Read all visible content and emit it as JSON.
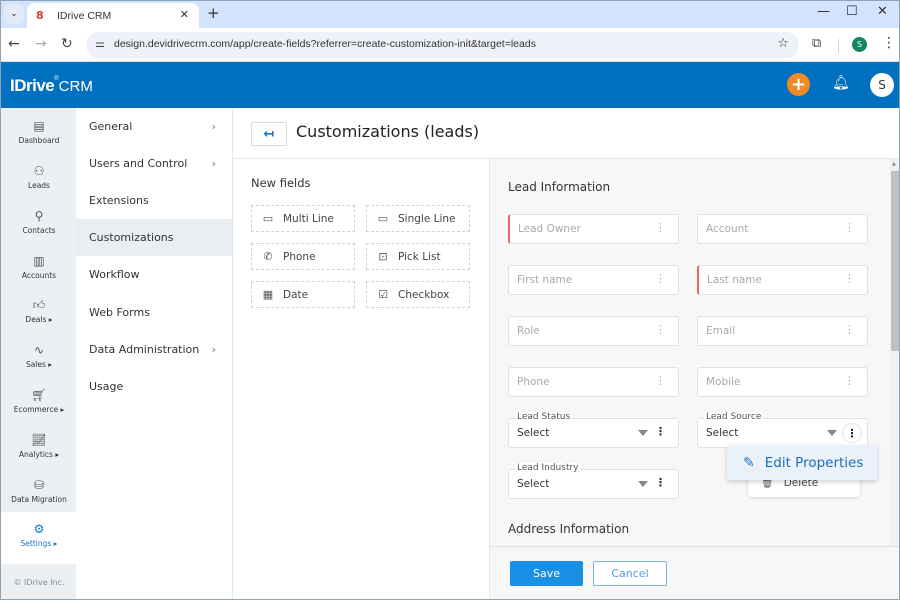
{
  "browser": {
    "tab_title": "IDrive CRM",
    "url": "design.devidrivecrm.com/app/create-fields?referrer=create-customization-init&target=leads",
    "profile_initial": "S"
  },
  "header": {
    "brand": "IDrive",
    "brand_reg": "®",
    "product": "CRM",
    "avatar_initial": "S",
    "accent_color": "#0070c0",
    "add_button_color": "#f08a24"
  },
  "rail": {
    "items": [
      {
        "label": "Dashboard",
        "icon": "dashboard-icon"
      },
      {
        "label": "Leads",
        "icon": "leads-icon"
      },
      {
        "label": "Contacts",
        "icon": "contacts-icon"
      },
      {
        "label": "Accounts",
        "icon": "accounts-icon"
      },
      {
        "label": "Deals ▸",
        "icon": "deals-icon"
      },
      {
        "label": "Sales ▸",
        "icon": "sales-icon"
      },
      {
        "label": "Ecommerce ▸",
        "icon": "ecommerce-icon"
      },
      {
        "label": "Analytics ▸",
        "icon": "analytics-icon"
      },
      {
        "label": "Data Migration",
        "icon": "data-migration-icon"
      },
      {
        "label": "Settings ▸",
        "icon": "settings-icon",
        "active": true
      }
    ],
    "footer": "© IDrive Inc."
  },
  "settings_menu": {
    "items": [
      {
        "label": "General",
        "has_submenu": true
      },
      {
        "label": "Users and Control",
        "has_submenu": true
      },
      {
        "label": "Extensions",
        "has_submenu": false
      },
      {
        "label": "Customizations",
        "has_submenu": false,
        "active": true
      },
      {
        "label": "Workflow",
        "has_submenu": false
      },
      {
        "label": "Web Forms",
        "has_submenu": false
      },
      {
        "label": "Data Administration",
        "has_submenu": true
      },
      {
        "label": "Usage",
        "has_submenu": false
      }
    ]
  },
  "page": {
    "title": "Customizations (leads)"
  },
  "new_fields": {
    "title": "New fields",
    "items": [
      {
        "label": "Multi Line",
        "icon": "multi-line-icon"
      },
      {
        "label": "Single Line",
        "icon": "single-line-icon"
      },
      {
        "label": "Phone",
        "icon": "phone-icon"
      },
      {
        "label": "Pick List",
        "icon": "pick-list-icon"
      },
      {
        "label": "Date",
        "icon": "calendar-icon"
      },
      {
        "label": "Checkbox",
        "icon": "checkbox-icon"
      }
    ]
  },
  "form": {
    "sections": [
      {
        "title": "Lead Information"
      },
      {
        "title": "Address Information"
      }
    ],
    "fields": [
      {
        "placeholder": "Lead Owner",
        "required": true
      },
      {
        "placeholder": "Account",
        "required": false
      },
      {
        "placeholder": "First name",
        "required": false
      },
      {
        "placeholder": "Last name",
        "required": true
      },
      {
        "placeholder": "Role",
        "required": false
      },
      {
        "placeholder": "Email",
        "required": false
      },
      {
        "placeholder": "Phone",
        "required": false
      },
      {
        "placeholder": "Mobile",
        "required": false
      }
    ],
    "selects": [
      {
        "label": "Lead Status",
        "value": "Select"
      },
      {
        "label": "Lead Source",
        "value": "Select"
      },
      {
        "label": "Lead Industry",
        "value": "Select"
      }
    ]
  },
  "context_menu": {
    "edit_label": "Edit Properties",
    "delete_label": "Delete"
  },
  "footer": {
    "save_label": "Save",
    "cancel_label": "Cancel"
  }
}
